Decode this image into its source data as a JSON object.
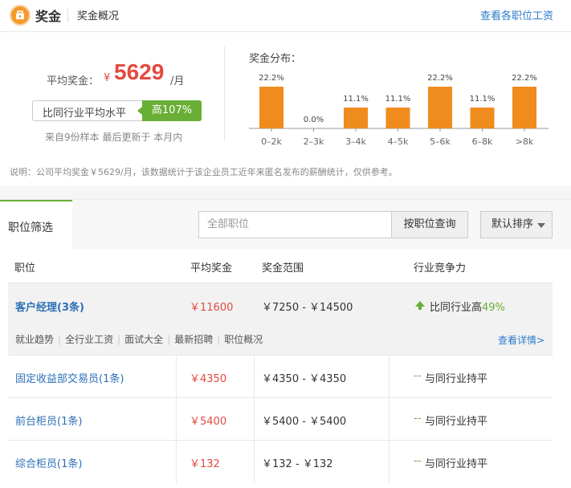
{
  "header": {
    "title": "奖金",
    "subtitle": "奖金概况",
    "link": "查看各职位工资"
  },
  "overview": {
    "avg_label": "平均奖金：",
    "currency": "¥",
    "avg_value": "5629",
    "unit": "/月",
    "compare_text": "比同行业平均水平",
    "compare_badge": "高107%",
    "sample_text": "来自9份样本   最后更新于 本月内",
    "dist_title": "奖金分布："
  },
  "chart_data": {
    "type": "bar",
    "categories": [
      "0–2k",
      "2–3k",
      "3–4k",
      "4–5k",
      "5–6k",
      "6–8k",
      ">8k"
    ],
    "values": [
      22.2,
      0.0,
      11.1,
      11.1,
      22.2,
      11.1,
      22.2
    ],
    "labels": [
      "22.2%",
      "0.0%",
      "11.1%",
      "11.1%",
      "22.2%",
      "11.1%",
      "22.2%"
    ],
    "color": "#f08c1e",
    "ylim": [
      0,
      22.2
    ]
  },
  "note": "说明：公司平均奖金￥5629/月，该数据统计于该企业员工近年来匿名发布的薪酬统计，仅供参考。",
  "filter": {
    "tab_label": "职位筛选",
    "search_placeholder": "全部职位",
    "search_button": "按职位查询",
    "sort_button": "默认排序"
  },
  "table": {
    "headers": [
      "职位",
      "平均奖金",
      "奖金范围",
      "行业竞争力"
    ],
    "featured": {
      "job": "客户经理(3条)",
      "avg": "￥11600",
      "range": "￥7250 - ￥14500",
      "compete_prefix": "比同行业高",
      "compete_pct": "49%",
      "links": [
        "就业趋势",
        "全行业工资",
        "面试大全",
        "最新招聘",
        "职位概况"
      ],
      "detail": "查看详情>"
    },
    "rows": [
      {
        "job": "固定收益部交易员(1条)",
        "avg": "￥4350",
        "range": "￥4350 - ￥4350",
        "compete": "与同行业持平"
      },
      {
        "job": "前台柜员(1条)",
        "avg": "￥5400",
        "range": "￥5400 - ￥5400",
        "compete": "与同行业持平"
      },
      {
        "job": "综合柜员(1条)",
        "avg": "￥132",
        "range": "￥132 - ￥132",
        "compete": "与同行业持平"
      }
    ],
    "dash": "--"
  }
}
